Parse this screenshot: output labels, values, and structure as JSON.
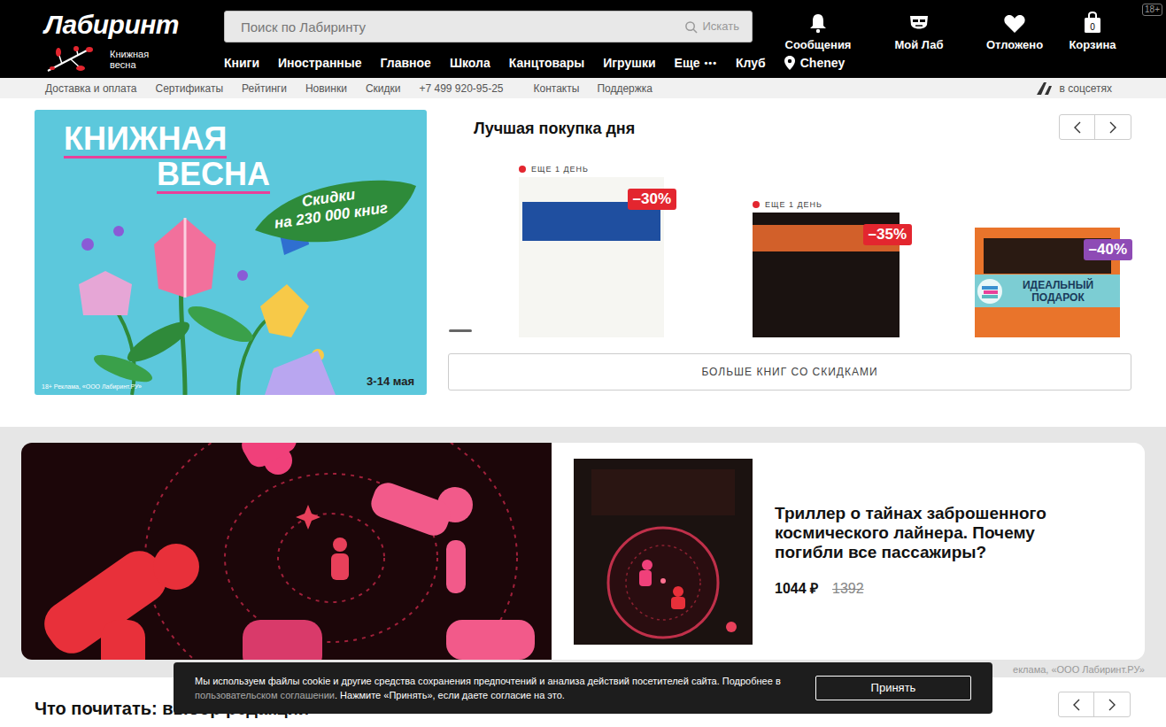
{
  "header": {
    "logo": "Лабиринт",
    "promo": "Книжная весна",
    "search": {
      "placeholder": "Поиск по Лабиринту",
      "button": "Искать"
    },
    "actions": [
      {
        "label": "Сообщения"
      },
      {
        "label": "Мой Лаб"
      },
      {
        "label": "Отложено"
      },
      {
        "label": "Корзина",
        "count": "0"
      }
    ],
    "age": "18+"
  },
  "nav": {
    "items": [
      {
        "label": "Книги"
      },
      {
        "label": "Иностранные"
      },
      {
        "label": "Главное"
      },
      {
        "label": "Школа"
      },
      {
        "label": "Канцтовары"
      },
      {
        "label": "Игрушки"
      },
      {
        "label": "Еще",
        "more": "•••"
      },
      {
        "label": "Клуб"
      }
    ],
    "location": "Cheney"
  },
  "subnav": {
    "links": [
      "Доставка и оплата",
      "Сертификаты",
      "Рейтинги",
      "Новинки",
      "Скидки"
    ],
    "phone": "+7 499 920-95-25",
    "support": [
      "Контакты",
      "Поддержка"
    ],
    "social": "в соцсетях"
  },
  "promo_banner": {
    "title": [
      "КНИЖНАЯ",
      "ВЕСНА"
    ],
    "leaf": [
      "Скидки",
      "на 230 000 книг"
    ],
    "dates": "3-14 мая",
    "ad": "18+ Реклама, «ООО Лабиринт.РУ»"
  },
  "deals": {
    "title": "Лучшая покупка дня",
    "books": [
      {
        "timer": "ЕЩЕ 1 ДЕНЬ",
        "discount": "–30%",
        "color": "#e3262f"
      },
      {
        "timer": "ЕЩЕ 1 ДЕНЬ",
        "discount": "–35%",
        "color": "#e3262f"
      },
      {
        "discount": "–40%",
        "color": "#8e4bb5",
        "gift": "ИДЕАЛЬНЫЙ ПОДАРОК"
      }
    ],
    "more": "БОЛЬШЕ КНИГ СО СКИДКАМИ"
  },
  "feature": {
    "text": "Триллер о тайнах заброшенного космического лайнера. Почему погибли все пассажиры?",
    "price": "1044 ₽",
    "old_price": "1392",
    "ad": "еклама, «ООО Лабиринт.РУ»"
  },
  "editors": {
    "title": "Что почитать: выбор редакции"
  },
  "cookie": {
    "before": "Мы используем файлы cookie и другие средства сохранения предпочтений и анализа действий посетителей сайта. Подробнее в ",
    "link": "пользовательском соглашении",
    "after": ". Нажмите «Принять», если даете согласие на это.",
    "button": "Принять"
  }
}
